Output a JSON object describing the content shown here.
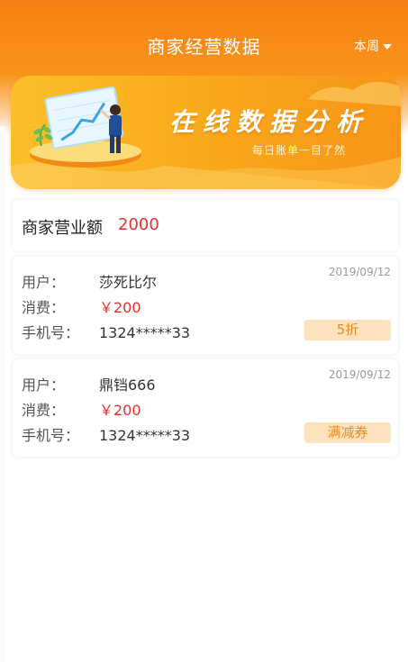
{
  "header": {
    "title": "商家经营数据",
    "period": "本周"
  },
  "banner": {
    "title": "在线数据分析",
    "subtitle": "每日账单一目了然"
  },
  "summary": {
    "label": "商家营业额",
    "value": "2000"
  },
  "records": [
    {
      "user_label": "用户：",
      "user": "莎死比尔",
      "amount_label": "消费：",
      "amount": "￥200",
      "phone_label": "手机号：",
      "phone": "1324*****33",
      "date": "2019/09/12",
      "tag": "5折"
    },
    {
      "user_label": "用户：",
      "user": "鼎铛666",
      "amount_label": "消费：",
      "amount": "￥200",
      "phone_label": "手机号：",
      "phone": "1324*****33",
      "date": "2019/09/12",
      "tag": "满减券"
    }
  ],
  "colors": {
    "brand_orange": "#f77f14",
    "price_red": "#e8302a",
    "tag_bg": "#fde3bd",
    "tag_text": "#f08a1c"
  }
}
